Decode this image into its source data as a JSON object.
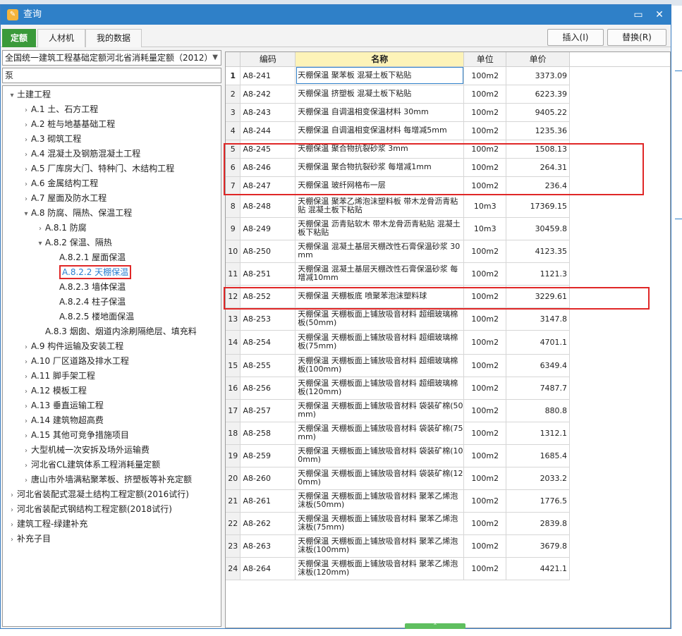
{
  "window": {
    "title": "查询",
    "minimize_icon": "minimize-icon",
    "close_icon": "close-icon"
  },
  "tabs": [
    {
      "label": "定额",
      "active": true
    },
    {
      "label": "人材机",
      "active": false
    },
    {
      "label": "我的数据",
      "active": false
    }
  ],
  "toolbar": {
    "insert_label": "插入(I)",
    "replace_label": "替换(R)"
  },
  "library": {
    "selected": "全国统一建筑工程基础定额河北省消耗量定额（2012）"
  },
  "search": {
    "value": "泵"
  },
  "tree": [
    {
      "label": "土建工程",
      "toggle": "▾",
      "selected": false
    },
    {
      "label": "A.1 土、石方工程",
      "toggle": "›",
      "selected": false
    },
    {
      "label": "A.2 桩与地基基础工程",
      "toggle": "›",
      "selected": false
    },
    {
      "label": "A.3 砌筑工程",
      "toggle": "›",
      "selected": false
    },
    {
      "label": "A.4 混凝土及钢筋混凝土工程",
      "toggle": "›",
      "selected": false
    },
    {
      "label": "A.5 厂库房大门、特种门、木结构工程",
      "toggle": "›",
      "selected": false
    },
    {
      "label": "A.6 金属结构工程",
      "toggle": "›",
      "selected": false
    },
    {
      "label": "A.7 屋面及防水工程",
      "toggle": "›",
      "selected": false
    },
    {
      "label": "A.8 防腐、隔热、保温工程",
      "toggle": "▾",
      "selected": false
    },
    {
      "label": "A.8.1 防腐",
      "toggle": "›",
      "selected": false
    },
    {
      "label": "A.8.2 保温、隔热",
      "toggle": "▾",
      "selected": false
    },
    {
      "label": "A.8.2.1 屋面保温",
      "toggle": "",
      "selected": false
    },
    {
      "label": "A.8.2.2 天棚保温",
      "toggle": "",
      "selected": true
    },
    {
      "label": "A.8.2.3 墙体保温",
      "toggle": "",
      "selected": false
    },
    {
      "label": "A.8.2.4 柱子保温",
      "toggle": "",
      "selected": false
    },
    {
      "label": "A.8.2.5 楼地面保温",
      "toggle": "",
      "selected": false
    },
    {
      "label": "A.8.3 烟囱、烟道内涂刷隔绝层、填充料",
      "toggle": "",
      "selected": false
    },
    {
      "label": "A.9 构件运输及安装工程",
      "toggle": "›",
      "selected": false
    },
    {
      "label": "A.10 厂区道路及排水工程",
      "toggle": "›",
      "selected": false
    },
    {
      "label": "A.11 脚手架工程",
      "toggle": "›",
      "selected": false
    },
    {
      "label": "A.12 模板工程",
      "toggle": "›",
      "selected": false
    },
    {
      "label": "A.13 垂直运输工程",
      "toggle": "›",
      "selected": false
    },
    {
      "label": "A.14 建筑物超高费",
      "toggle": "›",
      "selected": false
    },
    {
      "label": "A.15 其他可竞争措施项目",
      "toggle": "›",
      "selected": false
    },
    {
      "label": "大型机械一次安拆及场外运输费",
      "toggle": "›",
      "selected": false
    },
    {
      "label": "河北省CL建筑体系工程消耗量定额",
      "toggle": "›",
      "selected": false
    },
    {
      "label": "唐山市外墙满粘聚苯板、挤塑板等补充定额",
      "toggle": "›",
      "selected": false
    },
    {
      "label": "河北省装配式混凝土结构工程定额(2016试行)",
      "toggle": "›",
      "selected": false
    },
    {
      "label": "河北省装配式钢结构工程定额(2018试行)",
      "toggle": "›",
      "selected": false
    },
    {
      "label": "建筑工程-绿建补充",
      "toggle": "›",
      "selected": false
    },
    {
      "label": "补充子目",
      "toggle": "›",
      "selected": false
    }
  ],
  "grid": {
    "headers": {
      "no": "",
      "code": "编码",
      "name": "名称",
      "unit": "单位",
      "price": "单价"
    },
    "rows": [
      {
        "no": "1",
        "code": "A8-241",
        "name": "天棚保温 聚苯板 混凝土板下粘贴",
        "unit": "100m2",
        "price": "3373.09"
      },
      {
        "no": "2",
        "code": "A8-242",
        "name": "天棚保温 挤塑板 混凝土板下粘贴",
        "unit": "100m2",
        "price": "6223.39"
      },
      {
        "no": "3",
        "code": "A8-243",
        "name": "天棚保温 自调温相变保温材料 30mm",
        "unit": "100m2",
        "price": "9405.22"
      },
      {
        "no": "4",
        "code": "A8-244",
        "name": "天棚保温 自调温相变保温材料 每增减5mm",
        "unit": "100m2",
        "price": "1235.36"
      },
      {
        "no": "5",
        "code": "A8-245",
        "name": "天棚保温 聚合物抗裂砂浆 3mm",
        "unit": "100m2",
        "price": "1508.13"
      },
      {
        "no": "6",
        "code": "A8-246",
        "name": "天棚保温 聚合物抗裂砂浆 每增减1mm",
        "unit": "100m2",
        "price": "264.31"
      },
      {
        "no": "7",
        "code": "A8-247",
        "name": "天棚保温 玻纤网格布一层",
        "unit": "100m2",
        "price": "236.4"
      },
      {
        "no": "8",
        "code": "A8-248",
        "name": "天棚保温 聚苯乙烯泡沫塑料板 带木龙骨沥青粘贴 混凝土板下粘贴",
        "unit": "10m3",
        "price": "17369.15"
      },
      {
        "no": "9",
        "code": "A8-249",
        "name": "天棚保温 沥青贴软木 带木龙骨沥青粘贴 混凝土板下粘贴",
        "unit": "10m3",
        "price": "30459.8"
      },
      {
        "no": "10",
        "code": "A8-250",
        "name": "天棚保温 混凝土基层天棚改性石膏保温砂浆 30mm",
        "unit": "100m2",
        "price": "4123.35"
      },
      {
        "no": "11",
        "code": "A8-251",
        "name": "天棚保温 混凝土基层天棚改性石膏保温砂浆 每增减10mm",
        "unit": "100m2",
        "price": "1121.3"
      },
      {
        "no": "12",
        "code": "A8-252",
        "name": "天棚保温 天棚板底 喷聚苯泡沫塑料球",
        "unit": "100m2",
        "price": "3229.61"
      },
      {
        "no": "13",
        "code": "A8-253",
        "name": "天棚保温 天棚板面上铺放吸音材料 超细玻璃棉板(50mm)",
        "unit": "100m2",
        "price": "3147.8"
      },
      {
        "no": "14",
        "code": "A8-254",
        "name": "天棚保温 天棚板面上铺放吸音材料 超细玻璃棉板(75mm)",
        "unit": "100m2",
        "price": "4701.1"
      },
      {
        "no": "15",
        "code": "A8-255",
        "name": "天棚保温 天棚板面上铺放吸音材料 超细玻璃棉板(100mm)",
        "unit": "100m2",
        "price": "6349.4"
      },
      {
        "no": "16",
        "code": "A8-256",
        "name": "天棚保温 天棚板面上铺放吸音材料 超细玻璃棉板(120mm)",
        "unit": "100m2",
        "price": "7487.7"
      },
      {
        "no": "17",
        "code": "A8-257",
        "name": "天棚保温 天棚板面上铺放吸音材料 袋装矿棉(50mm)",
        "unit": "100m2",
        "price": "880.8"
      },
      {
        "no": "18",
        "code": "A8-258",
        "name": "天棚保温 天棚板面上铺放吸音材料 袋装矿棉(75mm)",
        "unit": "100m2",
        "price": "1312.1"
      },
      {
        "no": "19",
        "code": "A8-259",
        "name": "天棚保温 天棚板面上铺放吸音材料 袋装矿棉(100mm)",
        "unit": "100m2",
        "price": "1685.4"
      },
      {
        "no": "20",
        "code": "A8-260",
        "name": "天棚保温 天棚板面上铺放吸音材料 袋装矿棉(120mm)",
        "unit": "100m2",
        "price": "2033.2"
      },
      {
        "no": "21",
        "code": "A8-261",
        "name": "天棚保温 天棚板面上铺放吸音材料 聚苯乙烯泡沫板(50mm)",
        "unit": "100m2",
        "price": "1776.5"
      },
      {
        "no": "22",
        "code": "A8-262",
        "name": "天棚保温 天棚板面上铺放吸音材料 聚苯乙烯泡沫板(75mm)",
        "unit": "100m2",
        "price": "2839.8"
      },
      {
        "no": "23",
        "code": "A8-263",
        "name": "天棚保温 天棚板面上铺放吸音材料 聚苯乙烯泡沫板(100mm)",
        "unit": "100m2",
        "price": "3679.8"
      },
      {
        "no": "24",
        "code": "A8-264",
        "name": "天棚保温 天棚板面上铺放吸音材料 聚苯乙烯泡沫板(120mm)",
        "unit": "100m2",
        "price": "4421.1"
      }
    ]
  },
  "colors": {
    "titlebar": "#2f80c8",
    "active_tab": "#3a9a3a",
    "highlight": "#e02727",
    "name_header": "#fdf3b8"
  }
}
